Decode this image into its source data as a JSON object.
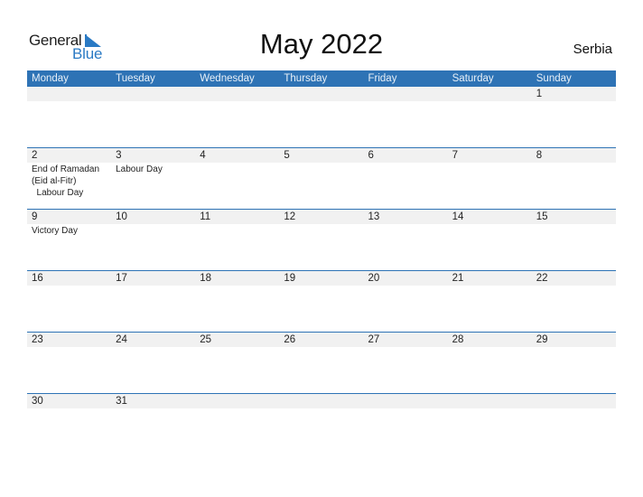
{
  "logo": {
    "general": "General",
    "blue": "Blue"
  },
  "title": "May 2022",
  "country": "Serbia",
  "colors": {
    "accent": "#2e73b5",
    "band": "#f1f1f1",
    "logo_blue": "#2a7ac4"
  },
  "weekdays": [
    "Monday",
    "Tuesday",
    "Wednesday",
    "Thursday",
    "Friday",
    "Saturday",
    "Sunday"
  ],
  "weeks": [
    [
      {
        "day": "",
        "events": ""
      },
      {
        "day": "",
        "events": ""
      },
      {
        "day": "",
        "events": ""
      },
      {
        "day": "",
        "events": ""
      },
      {
        "day": "",
        "events": ""
      },
      {
        "day": "",
        "events": ""
      },
      {
        "day": "1",
        "events": ""
      }
    ],
    [
      {
        "day": "2",
        "events": "End of Ramadan\n(Eid al-Fitr)\n  Labour Day"
      },
      {
        "day": "3",
        "events": "Labour Day"
      },
      {
        "day": "4",
        "events": ""
      },
      {
        "day": "5",
        "events": ""
      },
      {
        "day": "6",
        "events": ""
      },
      {
        "day": "7",
        "events": ""
      },
      {
        "day": "8",
        "events": ""
      }
    ],
    [
      {
        "day": "9",
        "events": "Victory Day"
      },
      {
        "day": "10",
        "events": ""
      },
      {
        "day": "11",
        "events": ""
      },
      {
        "day": "12",
        "events": ""
      },
      {
        "day": "13",
        "events": ""
      },
      {
        "day": "14",
        "events": ""
      },
      {
        "day": "15",
        "events": ""
      }
    ],
    [
      {
        "day": "16",
        "events": ""
      },
      {
        "day": "17",
        "events": ""
      },
      {
        "day": "18",
        "events": ""
      },
      {
        "day": "19",
        "events": ""
      },
      {
        "day": "20",
        "events": ""
      },
      {
        "day": "21",
        "events": ""
      },
      {
        "day": "22",
        "events": ""
      }
    ],
    [
      {
        "day": "23",
        "events": ""
      },
      {
        "day": "24",
        "events": ""
      },
      {
        "day": "25",
        "events": ""
      },
      {
        "day": "26",
        "events": ""
      },
      {
        "day": "27",
        "events": ""
      },
      {
        "day": "28",
        "events": ""
      },
      {
        "day": "29",
        "events": ""
      }
    ],
    [
      {
        "day": "30",
        "events": ""
      },
      {
        "day": "31",
        "events": ""
      },
      {
        "day": "",
        "events": ""
      },
      {
        "day": "",
        "events": ""
      },
      {
        "day": "",
        "events": ""
      },
      {
        "day": "",
        "events": ""
      },
      {
        "day": "",
        "events": ""
      }
    ]
  ]
}
